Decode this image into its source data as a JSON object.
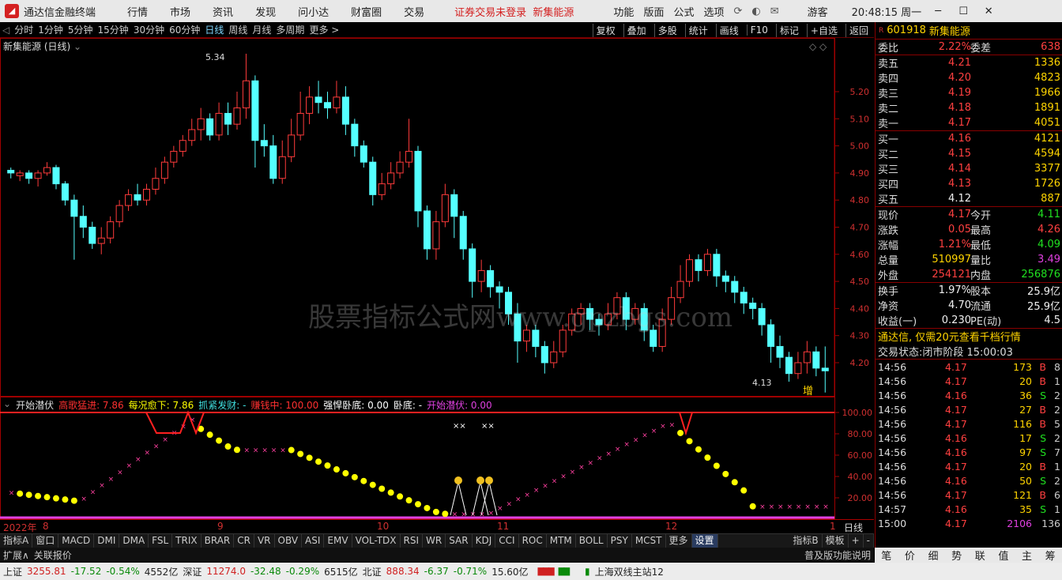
{
  "topbar": {
    "app_name": "通达信金融终端",
    "menus": [
      "行情",
      "市场",
      "资讯",
      "发现",
      "问小达",
      "财富圈",
      "交易"
    ],
    "warning": "证券交易未登录",
    "warning2": "新集能源",
    "right_menus": [
      "功能",
      "版面",
      "公式",
      "选项"
    ],
    "guest": "游客",
    "clock": "20:48:15 周一"
  },
  "periods": [
    "分时",
    "1分钟",
    "5分钟",
    "15分钟",
    "30分钟",
    "60分钟",
    "日线",
    "周线",
    "月线",
    "多周期",
    "更多 >"
  ],
  "active_period": "日线",
  "chart_buttons": [
    "复权",
    "叠加",
    "多股",
    "统计",
    "画线",
    "F10",
    "标记",
    "+自选",
    "返回"
  ],
  "chart": {
    "title": "新集能源 (日线)",
    "high_label": "5.34",
    "low_label": "4.13",
    "watermark": "股票指标公式网www.gpzbgs.com",
    "zeng": "增",
    "y_ticks": [
      "5.20",
      "5.10",
      "5.00",
      "4.90",
      "4.80",
      "4.70",
      "4.60",
      "4.50",
      "4.40",
      "4.30",
      "4.20"
    ]
  },
  "indicator": {
    "name": "开始潜伏",
    "items": [
      {
        "label": "高歌猛进: 7.86",
        "color": "#ff3030"
      },
      {
        "label": "每况愈下: 7.86",
        "color": "#ffff00"
      },
      {
        "label": "抓紧发财: -",
        "color": "#40e0e0"
      },
      {
        "label": "赚钱中: 100.00",
        "color": "#ff3030"
      },
      {
        "label": "强悍卧底: 0.00",
        "color": "#ffffff"
      },
      {
        "label": "卧底: -",
        "color": "#ffffff"
      },
      {
        "label": "开始潜伏: 0.00",
        "color": "#e040e0"
      }
    ],
    "y_ticks": [
      "100.00",
      "80.00",
      "60.00",
      "40.00",
      "20.00"
    ]
  },
  "date_axis": [
    "2022年",
    "8",
    "9",
    "10",
    "11",
    "12",
    "1",
    "日线"
  ],
  "tabs": [
    "指标A",
    "窗口",
    "MACD",
    "DMI",
    "DMA",
    "FSL",
    "TRIX",
    "BRAR",
    "CR",
    "VR",
    "OBV",
    "ASI",
    "EMV",
    "VOL-TDX",
    "RSI",
    "WR",
    "SAR",
    "KDJ",
    "CCI",
    "ROC",
    "MTM",
    "BOLL",
    "PSY",
    "MCST",
    "更多",
    "设置"
  ],
  "tabs_right": [
    "指标B",
    "模板",
    "+",
    "-"
  ],
  "expand": {
    "label": "扩展∧",
    "link": "关联报价",
    "right1": "普及版功能说明"
  },
  "side": {
    "code": "601918",
    "name": "新集能源",
    "weibi": {
      "label": "委比",
      "value": "2.22%",
      "label2": "委差",
      "value2": "638"
    },
    "sell": [
      {
        "label": "卖五",
        "price": "4.21",
        "vol": "1336"
      },
      {
        "label": "卖四",
        "price": "4.20",
        "vol": "4823"
      },
      {
        "label": "卖三",
        "price": "4.19",
        "vol": "1966"
      },
      {
        "label": "卖二",
        "price": "4.18",
        "vol": "1891"
      },
      {
        "label": "卖一",
        "price": "4.17",
        "vol": "4051"
      }
    ],
    "buy": [
      {
        "label": "买一",
        "price": "4.16",
        "vol": "4121"
      },
      {
        "label": "买二",
        "price": "4.15",
        "vol": "4594"
      },
      {
        "label": "买三",
        "price": "4.14",
        "vol": "3377"
      },
      {
        "label": "买四",
        "price": "4.13",
        "vol": "1726"
      },
      {
        "label": "买五",
        "price": "4.12",
        "vol": "887"
      }
    ],
    "stats": [
      {
        "a": "现价",
        "b": "4.17",
        "bc": "r",
        "c": "今开",
        "d": "4.11",
        "dc": "g"
      },
      {
        "a": "涨跌",
        "b": "0.05",
        "bc": "r",
        "c": "最高",
        "d": "4.26",
        "dc": "r"
      },
      {
        "a": "涨幅",
        "b": "1.21%",
        "bc": "r",
        "c": "最低",
        "d": "4.09",
        "dc": "g"
      },
      {
        "a": "总量",
        "b": "510997",
        "bc": "y",
        "c": "量比",
        "d": "3.49",
        "dc": "m"
      },
      {
        "a": "外盘",
        "b": "254121",
        "bc": "r",
        "c": "内盘",
        "d": "256876",
        "dc": "g"
      }
    ],
    "stats2": [
      {
        "a": "换手",
        "b": "1.97%",
        "c": "股本",
        "d": "25.9亿"
      },
      {
        "a": "净资",
        "b": "4.70",
        "c": "流通",
        "d": "25.9亿"
      },
      {
        "a": "收益(一)",
        "b": "0.230",
        "c": "PE(动)",
        "d": "4.5"
      }
    ],
    "ad": "通达信, 仅需20元查看千档行情",
    "trade_state": "交易状态:闭市阶段 15:00:03",
    "ticks": [
      {
        "t": "14:56",
        "p": "4.17",
        "pc": "r",
        "v": "173",
        "s": "B",
        "n": "8"
      },
      {
        "t": "14:56",
        "p": "4.17",
        "pc": "r",
        "v": "20",
        "s": "B",
        "n": "1"
      },
      {
        "t": "14:56",
        "p": "4.16",
        "pc": "r",
        "v": "36",
        "s": "S",
        "n": "2"
      },
      {
        "t": "14:56",
        "p": "4.17",
        "pc": "r",
        "v": "27",
        "s": "B",
        "n": "2"
      },
      {
        "t": "14:56",
        "p": "4.17",
        "pc": "r",
        "v": "116",
        "s": "B",
        "n": "5"
      },
      {
        "t": "14:56",
        "p": "4.16",
        "pc": "r",
        "v": "17",
        "s": "S",
        "n": "2"
      },
      {
        "t": "14:56",
        "p": "4.16",
        "pc": "r",
        "v": "97",
        "s": "S",
        "n": "7"
      },
      {
        "t": "14:56",
        "p": "4.17",
        "pc": "r",
        "v": "20",
        "s": "B",
        "n": "1"
      },
      {
        "t": "14:56",
        "p": "4.16",
        "pc": "r",
        "v": "50",
        "s": "S",
        "n": "2"
      },
      {
        "t": "14:56",
        "p": "4.17",
        "pc": "r",
        "v": "121",
        "s": "B",
        "n": "6"
      },
      {
        "t": "14:57",
        "p": "4.16",
        "pc": "r",
        "v": "35",
        "s": "S",
        "n": "1"
      },
      {
        "t": "15:00",
        "p": "4.17",
        "pc": "r",
        "v": "2106",
        "s": "",
        "n": "136"
      }
    ],
    "bottom_tabs": [
      "笔",
      "价",
      "细",
      "势",
      "联",
      "值",
      "主",
      "筹"
    ]
  },
  "statusbar": {
    "sh_label": "上证",
    "sh_val": "3255.81",
    "sh_chg": "-17.52",
    "sh_pct": "-0.54%",
    "sh_amt": "4552亿",
    "sz_label": "深证",
    "sz_val": "11274.0",
    "sz_chg": "-32.48",
    "sz_pct": "-0.29%",
    "sz_amt": "6515亿",
    "bz_label": "北证",
    "bz_val": "888.34",
    "bz_chg": "-6.37",
    "bz_pct": "-0.71%",
    "bz_amt": "15.60亿",
    "server": "上海双线主站12"
  }
}
